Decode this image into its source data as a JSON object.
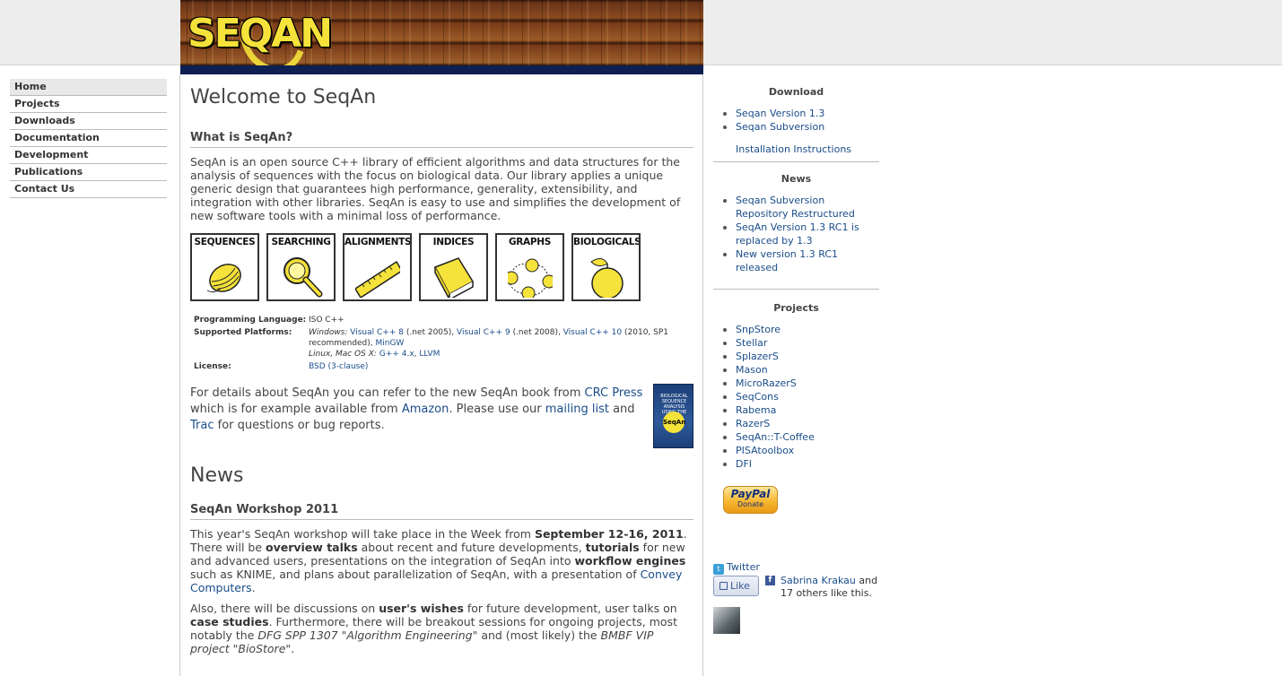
{
  "banner": {
    "logo_text": "SEQAN"
  },
  "nav": {
    "items": [
      {
        "label": "Home"
      },
      {
        "label": "Projects"
      },
      {
        "label": "Downloads"
      },
      {
        "label": "Documentation"
      },
      {
        "label": "Development"
      },
      {
        "label": "Publications"
      },
      {
        "label": "Contact Us"
      }
    ]
  },
  "main": {
    "title": "Welcome to SeqAn",
    "what_heading": "What is SeqAn?",
    "intro": "SeqAn is an open source C++ library of efficient algorithms and data structures for the analysis of sequences with the focus on biological data. Our library applies a unique generic design that guarantees high performance, generality, extensibility, and integration with other libraries. SeqAn is easy to use and simplifies the development of new software tools with a minimal loss of performance.",
    "categories": [
      {
        "label": "SEQUENCES",
        "icon": "thread-spool-icon"
      },
      {
        "label": "SEARCHING",
        "icon": "magnifier-icon"
      },
      {
        "label": "ALIGNMENTS",
        "icon": "ruler-icon"
      },
      {
        "label": "INDICES",
        "icon": "book-index-icon"
      },
      {
        "label": "GRAPHS",
        "icon": "graph-icon"
      },
      {
        "label": "BIOLOGICALS",
        "icon": "apple-icon"
      }
    ],
    "info": {
      "lang_key": "Programming Language:",
      "lang_val": "ISO C++",
      "plat_key": "Supported Platforms:",
      "win_prefix": "Windows:",
      "vc8": "Visual C++ 8",
      "vc8_note": "(.net 2005),",
      "vc9": "Visual C++ 9",
      "vc9_note": "(.net 2008),",
      "vc10": "Visual C++ 10",
      "vc10_note": "(2010, SP1 recommended),",
      "mingw": "MinGW",
      "unix_prefix": "Linux, Mac OS X:",
      "gpp": "G++ 4.x",
      "llvm": "LLVM",
      "lic_key": "License:",
      "lic_val": "BSD (3-clause)"
    },
    "book": {
      "title_lines": "BIOLOGICAL SEQUENCE ANALYSIS USING THE",
      "logo": "SeqAn",
      "sub": "LIBRARY"
    },
    "details": {
      "t1": "For details about SeqAn you can refer to the new SeqAn book from ",
      "crc": "CRC Press",
      "t2": " which is for example available from ",
      "amazon": "Amazon",
      "t3": ". Please use our ",
      "mailing": "mailing list",
      "t4": " and ",
      "trac": "Trac",
      "t5": " for questions or bug reports."
    },
    "news_title": "News",
    "workshop_heading": "SeqAn Workshop 2011",
    "w1": "This year's SeqAn workshop will take place in the Week from ",
    "w1b": "September 12-16, 2011",
    "w2": ". There will be ",
    "w2b": "overview talks",
    "w3": " about recent and future developments, ",
    "w3b": "tutorials",
    "w4": " for new and advanced users, presentations on the integration of SeqAn into ",
    "w4b": "workflow engines",
    "w5": " such as KNIME, and plans about parallelization of SeqAn, with a presentation of ",
    "convey": "Convey Computers",
    "w6": ".",
    "a1": "Also, there will be discussions on ",
    "a1b": "user's wishes",
    "a2": " for future development, user talks on ",
    "a2b": "case studies",
    "a3": ". Furthermore, there will be breakout sessions for ongoing projects, most notably the ",
    "a3i": "DFG SPP 1307 \"Algorithm Engineering\"",
    "a4": " and (most likely) the ",
    "a4i": "BMBF VIP project \"BioStore\"",
    "a5": "."
  },
  "sidebar": {
    "download_heading": "Download",
    "download_items": [
      "Seqan Version 1.3",
      "Seqan Subversion"
    ],
    "install_link": "Installation Instructions",
    "news_heading": "News",
    "news_items": [
      "Seqan Subversion Repository Restructured",
      "SeqAn Version 1.3 RC1 is replaced by 1.3",
      "New version 1.3 RC1 released"
    ],
    "projects_heading": "Projects",
    "projects": [
      "SnpStore",
      "Stellar",
      "SplazerS",
      "Mason",
      "MicroRazerS",
      "SeqCons",
      "Rabema",
      "RazerS",
      "SeqAn::T-Coffee",
      "PISAtoolbox",
      "DFI"
    ],
    "paypal_logo": "PayPal",
    "paypal_sub": "Donate",
    "twitter": "Twitter",
    "like": "Like",
    "fb_name": "Sabrina Krakau",
    "fb_rest": " and 17 others like this."
  }
}
